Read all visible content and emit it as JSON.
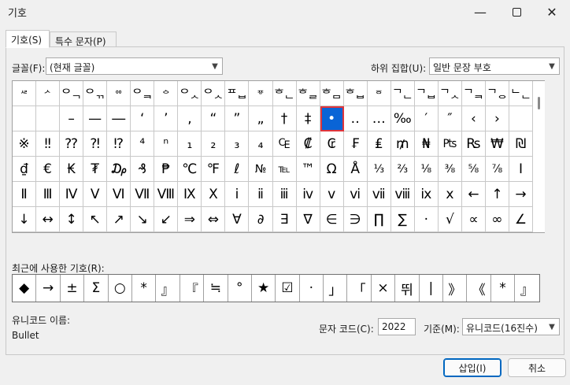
{
  "window": {
    "title": "기호"
  },
  "tabs": [
    {
      "label": "기호(S)"
    },
    {
      "label": "특수 문자(P)"
    }
  ],
  "font": {
    "label": "글꼴(F):",
    "value": "(현재 글꼴)"
  },
  "subset": {
    "label": "하위 집합(U):",
    "value": "일반 문장 부호"
  },
  "symbol_rows": [
    [
      "ᄰ",
      "ᄼ",
      "ᄋᆨ",
      "ᄋᆩ",
      "ᅇ",
      "ᄋᆿ",
      "ᅌ",
      "ᄋᆺ",
      "ᄋᆺ",
      "ᄑᆸ",
      "ᅗ",
      "ᄒᆫ",
      "ᄒᆯ",
      "ᄒᆷ",
      "ᄒᆸ",
      "ᅙ",
      "ᄀᆫ",
      "ᄀᆸ",
      "ᄀᆺ",
      "ᄀᆿ",
      "ᄀᆼ",
      "ᄂᆫ"
    ],
    [
      " ",
      " ",
      "–",
      "—",
      "―",
      "‘",
      "’",
      "‚",
      "“",
      "”",
      "„",
      "†",
      "‡",
      "•",
      "‥",
      "…",
      "‰",
      "′",
      "″",
      "‹",
      "›",
      ""
    ],
    [
      "※",
      "‼",
      "⁇",
      "⁈",
      "⁉",
      "⁴",
      "ⁿ",
      "₁",
      "₂",
      "₃",
      "₄",
      "₠",
      "₡",
      "₢",
      "₣",
      "₤",
      "₥",
      "₦",
      "₧",
      "₨",
      "₩",
      "₪"
    ],
    [
      "₫",
      "€",
      "₭",
      "₮",
      "₯",
      "₰",
      "₱",
      "℃",
      "℉",
      "ℓ",
      "№",
      "℡",
      "™",
      "Ω",
      "Å",
      "⅓",
      "⅔",
      "⅛",
      "⅜",
      "⅝",
      "⅞",
      "Ⅰ"
    ],
    [
      "Ⅱ",
      "Ⅲ",
      "Ⅳ",
      "Ⅴ",
      "Ⅵ",
      "Ⅶ",
      "Ⅷ",
      "Ⅸ",
      "Ⅹ",
      "ⅰ",
      "ⅱ",
      "ⅲ",
      "ⅳ",
      "ⅴ",
      "ⅵ",
      "ⅶ",
      "ⅷ",
      "ⅸ",
      "ⅹ",
      "←",
      "↑",
      "→"
    ],
    [
      "↓",
      "↔",
      "↕",
      "↖",
      "↗",
      "↘",
      "↙",
      "⇒",
      "⇔",
      "∀",
      "∂",
      "∃",
      "∇",
      "∈",
      "∋",
      "∏",
      "∑",
      "·",
      "√",
      "∝",
      "∞",
      "∠"
    ]
  ],
  "selected_symbol": "•",
  "recent": {
    "label": "최근에 사용한 기호(R):",
    "symbols": [
      "◆",
      "→",
      "±",
      "Σ",
      "○",
      "*",
      "』",
      "『",
      "≒",
      "°",
      "★",
      "☑",
      "·",
      "」",
      "「",
      "×",
      "뛰",
      "|",
      "》",
      "《",
      "*",
      "』"
    ]
  },
  "unicode_name": {
    "label": "유니코드 이름:",
    "value": "Bullet"
  },
  "char_code": {
    "label": "문자 코드(C):",
    "value": "2022"
  },
  "base": {
    "label": "기준(M):",
    "value": "유니코드(16진수)"
  },
  "buttons": {
    "insert": "삽입(I)",
    "cancel": "취소"
  }
}
